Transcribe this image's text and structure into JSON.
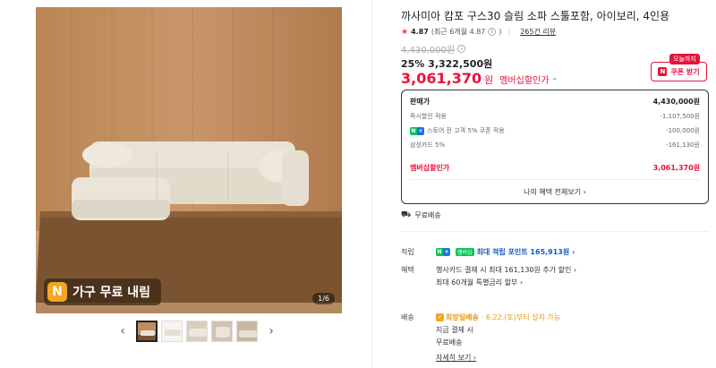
{
  "gallery": {
    "promo_badge_letter": "N",
    "promo_text": "가구 무료 내림",
    "counter": "1/6",
    "prev_icon": "‹",
    "next_icon": "›"
  },
  "product": {
    "title": "까사미아 캄포 구스30 슬림 소파 스툴포함, 아이보리, 4인용",
    "rating": "4.87",
    "rating_recent": "(최근 6개월 4.87",
    "rating_recent_close": ")",
    "review_count": "265건 리뷰",
    "original_price": "4,430,000원",
    "discount_line": "25% 3,322,500원",
    "member_price": "3,061,370",
    "member_unit": "원",
    "member_label": "멤버십할인가"
  },
  "coupon": {
    "today_badge": "오늘까지",
    "label": "쿠폰 받기",
    "badge_letter": "N"
  },
  "price_box": {
    "rows": [
      {
        "label": "판매가",
        "value": "4,430,000원"
      },
      {
        "label": "즉시할인 적용",
        "value": "-1,107,500원"
      },
      {
        "label": "스토어 전 고객 5% 쿠폰 적용",
        "value": "-100,000원"
      },
      {
        "label": "삼성카드 5%",
        "value": "-161,130원"
      },
      {
        "label": "멤버십할인가",
        "value": "3,061,370원"
      }
    ],
    "benefits_link": "나의 혜택 전체보기 ›"
  },
  "shipping_top": "무료배송",
  "points": {
    "label": "적립",
    "badge_text": "멤버십",
    "text": "최대 적립 포인트 165,913원 ›"
  },
  "benefit": {
    "label": "혜택",
    "line1": "행사카드 결제 시 최대 161,130원 추가 할인 ›",
    "line2": "최대 60개월 특별금리 할부 ›"
  },
  "delivery": {
    "label": "배송",
    "badge": "희망일배송",
    "date": "· 6.22.(토)부터 설치 가능",
    "line2": "지금 결제 시",
    "line3": "무료배송",
    "detail_link": "자세히 보기 ›"
  },
  "colors": {
    "accent_red": "#e8123b",
    "naver_green": "#03c75a",
    "link_blue": "#1a56c4",
    "orange": "#f5a623"
  }
}
